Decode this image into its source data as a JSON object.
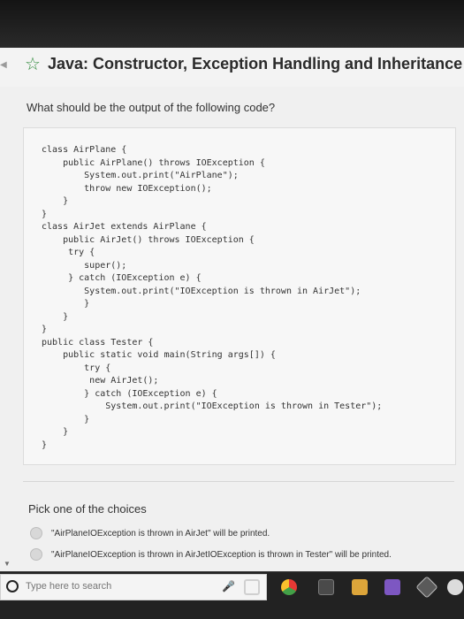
{
  "page": {
    "title": "Java: Constructor, Exception Handling and Inheritance",
    "question": "What should be the output of the following code?",
    "code": "class AirPlane {\n    public AirPlane() throws IOException {\n        System.out.print(\"AirPlane\");\n        throw new IOException();\n    }\n}\nclass AirJet extends AirPlane {\n    public AirJet() throws IOException {\n     try {\n        super();\n     } catch (IOException e) {\n        System.out.print(\"IOException is thrown in AirJet\");\n        }\n    }\n}\npublic class Tester {\n    public static void main(String args[]) {\n        try {\n         new AirJet();\n        } catch (IOException e) {\n            System.out.print(\"IOException is thrown in Tester\");\n        }\n    }\n}",
    "pick_label": "Pick one of the choices",
    "choices": [
      "\"AirPlaneIOException is thrown in AirJet\" will be printed.",
      "\"AirPlaneIOException is thrown in AirJetIOException is thrown in Tester\" will be printed."
    ]
  },
  "taskbar": {
    "search_placeholder": "Type here to search"
  },
  "icons": {
    "star": "star-icon",
    "search": "search-icon",
    "mic": "microphone-icon",
    "task_view": "task-view-icon",
    "chrome": "chrome-icon",
    "store": "store-icon",
    "folder": "folder-icon",
    "vs": "visual-studio-icon",
    "box": "box-icon",
    "github": "github-icon"
  },
  "colors": {
    "accent": "#2f8a3b"
  }
}
